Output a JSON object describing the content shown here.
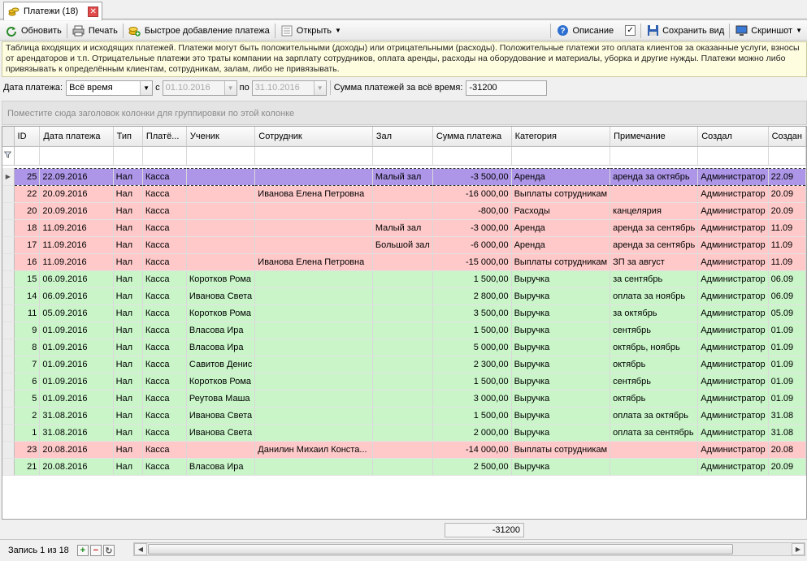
{
  "tab": {
    "title": "Платежи (18)",
    "close": "✕"
  },
  "toolbar": {
    "refresh": "Обновить",
    "print": "Печать",
    "quick_add": "Быстрое добавление платежа",
    "open": "Открыть",
    "description": "Описание",
    "save_view": "Сохранить вид",
    "screenshot": "Скриншот"
  },
  "info_text": "Таблица входящих и исходящих платежей. Платежи могут быть положительными (доходы) или отрицательными (расходы). Положительные платежи это оплата клиентов за оказанные услуги, взносы от арендаторов и т.п. Отрицательные платежи это траты компании на зарплату сотрудников, оплата аренды, расходы на оборудование и материалы, уборка и другие нужды. Платежи можно либо привязывать к определённым клиентам, сотрудникам, залам, либо не привязывать.",
  "filter": {
    "date_label": "Дата платежа:",
    "period_value": "Всё время",
    "from_label": "с",
    "from_value": "01.10.2016",
    "to_label": "по",
    "to_value": "31.10.2016",
    "sum_label": "Сумма платежей за всё время:",
    "sum_value": "-31200"
  },
  "group_panel_text": "Поместите сюда заголовок колонки для группировки по этой колонке",
  "columns": [
    "ID",
    "Дата платежа",
    "Тип",
    "Платё...",
    "Ученик",
    "Сотрудник",
    "Зал",
    "Сумма платежа",
    "Категория",
    "Примечание",
    "Создал",
    "Создан"
  ],
  "rows": [
    [
      "25",
      "22.09.2016",
      "Нал",
      "Касса",
      "",
      "",
      "Малый зал",
      "-3 500,00",
      "Аренда",
      "аренда за октябрь",
      "Администратор",
      "22.09"
    ],
    [
      "22",
      "20.09.2016",
      "Нал",
      "Касса",
      "",
      "Иванова Елена Петровна",
      "",
      "-16 000,00",
      "Выплаты сотрудникам",
      "",
      "Администратор",
      "20.09"
    ],
    [
      "20",
      "20.09.2016",
      "Нал",
      "Касса",
      "",
      "",
      "",
      "-800,00",
      "Расходы",
      "канцелярия",
      "Администратор",
      "20.09"
    ],
    [
      "18",
      "11.09.2016",
      "Нал",
      "Касса",
      "",
      "",
      "Малый зал",
      "-3 000,00",
      "Аренда",
      "аренда за сентябрь",
      "Администратор",
      "11.09"
    ],
    [
      "17",
      "11.09.2016",
      "Нал",
      "Касса",
      "",
      "",
      "Большой зал",
      "-6 000,00",
      "Аренда",
      "аренда за сентябрь",
      "Администратор",
      "11.09"
    ],
    [
      "16",
      "11.09.2016",
      "Нал",
      "Касса",
      "",
      "Иванова Елена Петровна",
      "",
      "-15 000,00",
      "Выплаты сотрудникам",
      "ЗП за август",
      "Администратор",
      "11.09"
    ],
    [
      "15",
      "06.09.2016",
      "Нал",
      "Касса",
      "Коротков Рома",
      "",
      "",
      "1 500,00",
      "Выручка",
      "за сентябрь",
      "Администратор",
      "06.09"
    ],
    [
      "14",
      "06.09.2016",
      "Нал",
      "Касса",
      "Иванова Света",
      "",
      "",
      "2 800,00",
      "Выручка",
      "оплата за ноябрь",
      "Администратор",
      "06.09"
    ],
    [
      "11",
      "05.09.2016",
      "Нал",
      "Касса",
      "Коротков Рома",
      "",
      "",
      "3 500,00",
      "Выручка",
      "за октябрь",
      "Администратор",
      "05.09"
    ],
    [
      "9",
      "01.09.2016",
      "Нал",
      "Касса",
      "Власова Ира",
      "",
      "",
      "1 500,00",
      "Выручка",
      "сентябрь",
      "Администратор",
      "01.09"
    ],
    [
      "8",
      "01.09.2016",
      "Нал",
      "Касса",
      "Власова Ира",
      "",
      "",
      "5 000,00",
      "Выручка",
      "октябрь, ноябрь",
      "Администратор",
      "01.09"
    ],
    [
      "7",
      "01.09.2016",
      "Нал",
      "Касса",
      "Савитов Денис",
      "",
      "",
      "2 300,00",
      "Выручка",
      "октябрь",
      "Администратор",
      "01.09"
    ],
    [
      "6",
      "01.09.2016",
      "Нал",
      "Касса",
      "Коротков Рома",
      "",
      "",
      "1 500,00",
      "Выручка",
      "сентябрь",
      "Администратор",
      "01.09"
    ],
    [
      "5",
      "01.09.2016",
      "Нал",
      "Касса",
      "Реутова Маша",
      "",
      "",
      "3 000,00",
      "Выручка",
      "октябрь",
      "Администратор",
      "01.09"
    ],
    [
      "2",
      "31.08.2016",
      "Нал",
      "Касса",
      "Иванова Света",
      "",
      "",
      "1 500,00",
      "Выручка",
      "оплата за октябрь",
      "Администратор",
      "31.08"
    ],
    [
      "1",
      "31.08.2016",
      "Нал",
      "Касса",
      "Иванова Света",
      "",
      "",
      "2 000,00",
      "Выручка",
      "оплата за сентябрь",
      "Администратор",
      "31.08"
    ],
    [
      "23",
      "20.08.2016",
      "Нал",
      "Касса",
      "",
      "Данилин Михаил Конста...",
      "",
      "-14 000,00",
      "Выплаты сотрудникам",
      "",
      "Администратор",
      "20.08"
    ],
    [
      "21",
      "20.08.2016",
      "Нал",
      "Касса",
      "Власова Ира",
      "",
      "",
      "2 500,00",
      "Выручка",
      "",
      "Администратор",
      "20.09"
    ]
  ],
  "total_sum": "-31200",
  "status": {
    "record_text": "Запись 1 из 18",
    "add": "+",
    "remove": "−",
    "refresh": "↻"
  },
  "colors": {
    "negative_row": "#ffc9c9",
    "positive_row": "#c9f5c9",
    "selected_row": "#ad96e8",
    "info_bg": "#fffde0"
  }
}
